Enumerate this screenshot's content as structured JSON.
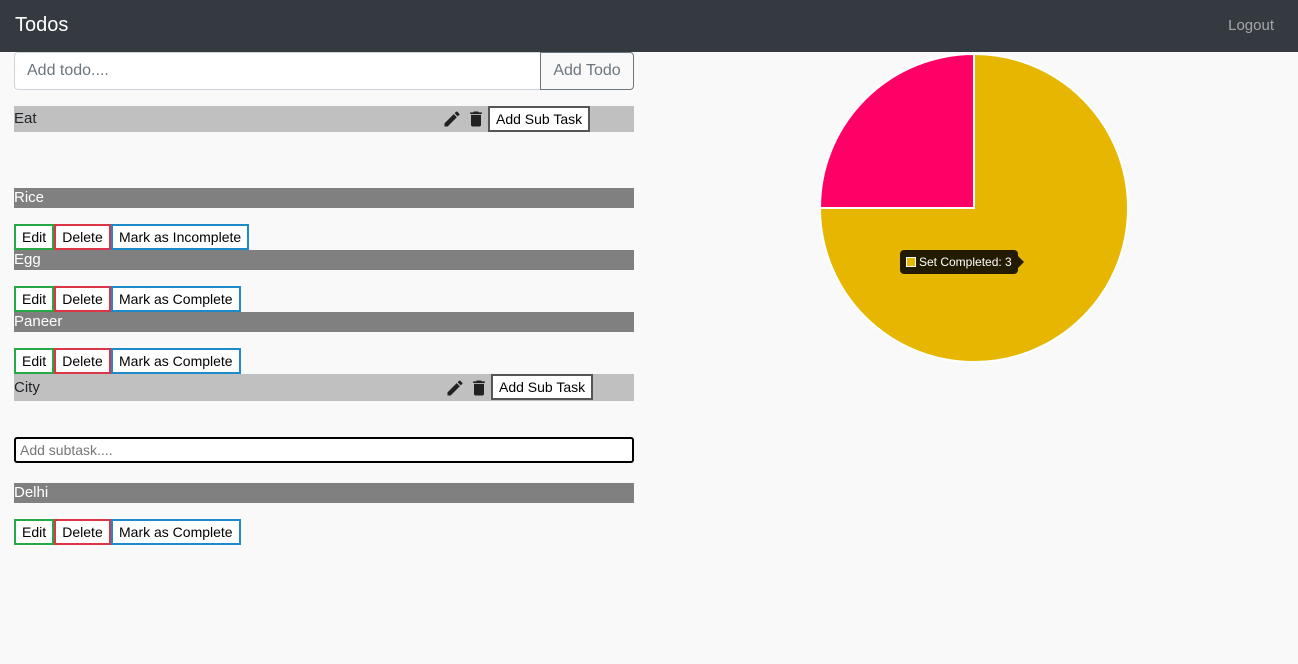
{
  "navbar": {
    "brand": "Todos",
    "logout": "Logout"
  },
  "add_todo": {
    "placeholder": "Add todo....",
    "button": "Add Todo"
  },
  "todos": [
    {
      "title": "Eat",
      "add_subtask_label": "Add Sub Task",
      "subtasks": [
        {
          "title": "Rice",
          "mark_label": "Mark as Incomplete"
        },
        {
          "title": "Egg",
          "mark_label": "Mark as Complete"
        },
        {
          "title": "Paneer",
          "mark_label": "Mark as Complete"
        }
      ]
    },
    {
      "title": "City",
      "add_subtask_label": "Add Sub Task",
      "subtask_placeholder": "Add subtask....",
      "subtasks": [
        {
          "title": "Delhi",
          "mark_label": "Mark as Complete"
        }
      ]
    }
  ],
  "labels": {
    "edit": "Edit",
    "delete": "Delete"
  },
  "chart_data": {
    "type": "pie",
    "slices": [
      {
        "name": "Set Completed",
        "value": 3,
        "color": "#e6b600"
      },
      {
        "name": "",
        "value": 1,
        "color": "#ff0066"
      }
    ],
    "tooltip": "Set Completed: 3"
  }
}
